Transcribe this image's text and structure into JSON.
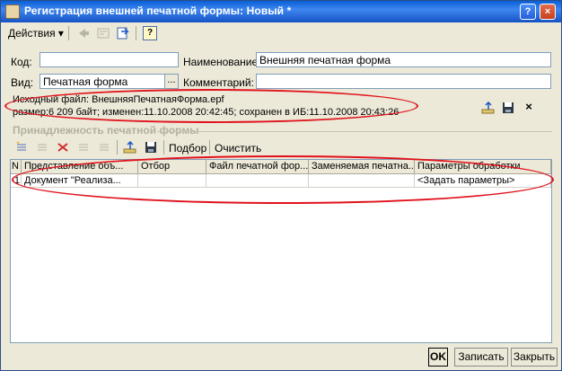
{
  "window": {
    "title": "Регистрация внешней печатной формы: Новый *",
    "help_label": "?",
    "close_label": "×"
  },
  "toolbar": {
    "actions_label": "Действия ▾",
    "help_label": "?"
  },
  "form": {
    "code_label": "Код:",
    "code_value": "",
    "name_label": "Наименование:",
    "name_value": "Внешняя печатная форма",
    "kind_label": "Вид:",
    "kind_value": "Печатная форма",
    "kind_button": "...",
    "comment_label": "Комментарий:",
    "comment_value": ""
  },
  "source": {
    "line1": "Исходный файл: ВнешняяПечатнаяФорма.epf",
    "line2": "размер:6 209 байт; изменен:11.10.2008 20:42:45; сохранен в ИБ:11.10.2008 20:43:26",
    "delete_label": "×"
  },
  "group": {
    "title": "Принадлежность печатной формы",
    "select_label": "Подбор",
    "clear_label": "Очистить"
  },
  "table": {
    "columns": [
      "N",
      "Представление объ...",
      "Отбор",
      "Файл печатной фор...",
      "Заменяемая печатна...",
      "Параметры обработки"
    ],
    "rows": [
      [
        "1",
        "Документ \"Реализа...",
        "",
        "",
        "",
        "<Задать параметры>"
      ]
    ]
  },
  "footer": {
    "ok_label": "OK",
    "save_label": "Записать",
    "close_label": "Закрыть"
  },
  "colors": {
    "titlebar": "#0a5fd6",
    "window_bg": "#ece9d8",
    "highlight": "#e0121c"
  }
}
